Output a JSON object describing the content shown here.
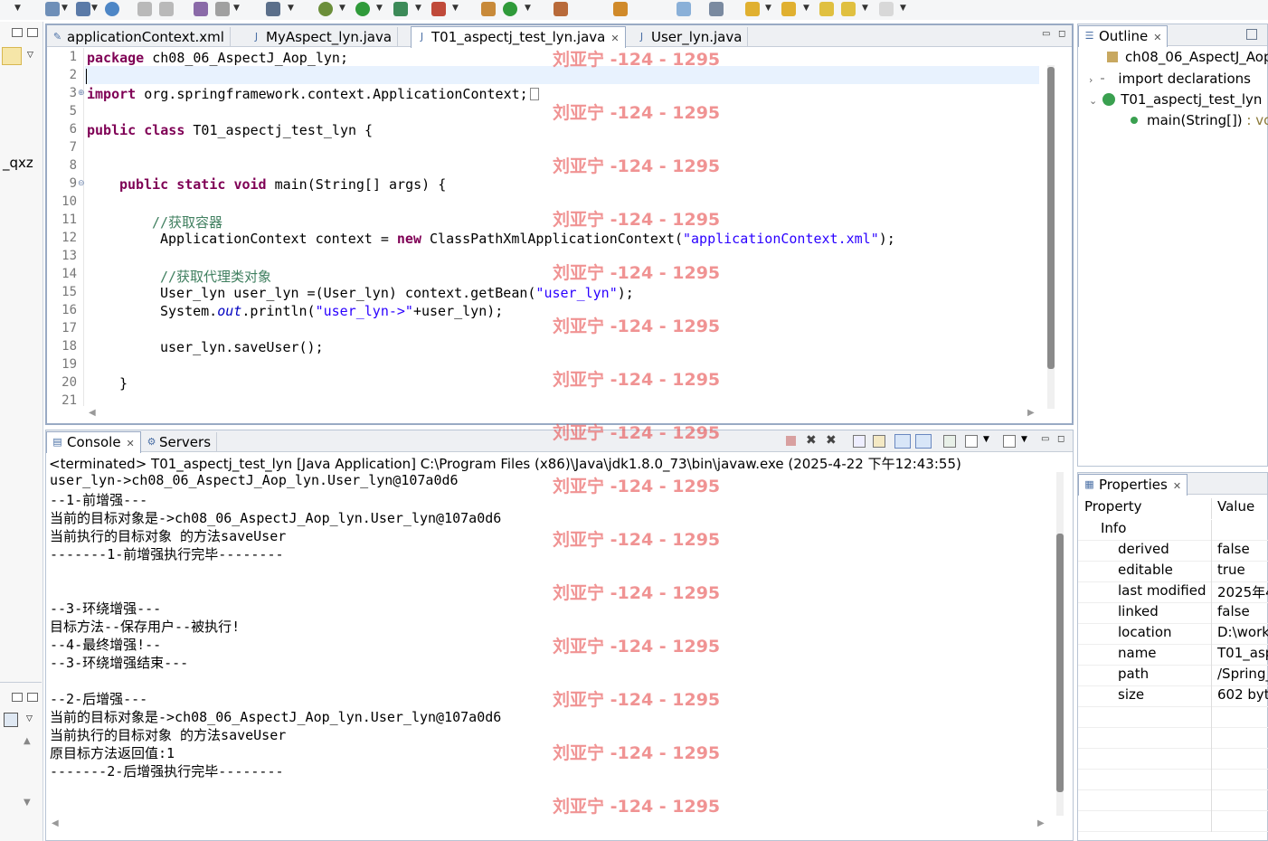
{
  "editor": {
    "tabs": [
      {
        "label": "applicationContext.xml",
        "icon": "xml-file-icon"
      },
      {
        "label": "MyAspect_lyn.java",
        "icon": "java-file-icon"
      },
      {
        "label": "T01_aspectj_test_lyn.java",
        "icon": "java-file-icon",
        "active": true
      },
      {
        "label": "User_lyn.java",
        "icon": "java-file-icon"
      }
    ],
    "line_numbers": [
      "1",
      "2",
      "3",
      "5",
      "6",
      "7",
      "8",
      "9",
      "10",
      "11",
      "12",
      "13",
      "14",
      "15",
      "16",
      "17",
      "18",
      "19",
      "20",
      "21"
    ],
    "code": {
      "l1_kw": "package",
      "l1_rest": " ch08_06_AspectJ_Aop_lyn;",
      "l3_kw": "import",
      "l3_rest": " org.springframework.context.ApplicationContext;",
      "l5_kw1": "public",
      "l5_kw2": "class",
      "l5_rest": " T01_aspectj_test_lyn {",
      "l8_kw1": "public",
      "l8_kw2": "static",
      "l8_kw3": "void",
      "l8_rest": " main(String[] args) {",
      "l10_cmt": "//获取容器",
      "l11_a": "ApplicationContext context = ",
      "l11_kw": "new",
      "l11_b": " ClassPathXmlApplicationContext(",
      "l11_str": "\"applicationContext.xml\"",
      "l11_c": ");",
      "l13_cmt": "//获取代理类对象",
      "l14_a": "User_lyn user_lyn =(User_lyn) context.getBean(",
      "l14_str": "\"user_lyn\"",
      "l14_b": ");",
      "l15_a": "System.",
      "l15_fld": "out",
      "l15_b": ".println(",
      "l15_str": "\"user_lyn->\"",
      "l15_c": "+user_lyn);",
      "l17": "user_lyn.saveUser();",
      "l19": "}"
    }
  },
  "console": {
    "tabs": [
      {
        "label": "Console",
        "icon": "console-icon"
      },
      {
        "label": "Servers",
        "icon": "servers-icon"
      }
    ],
    "header": "<terminated> T01_aspectj_test_lyn [Java Application] C:\\Program Files (x86)\\Java\\jdk1.8.0_73\\bin\\javaw.exe (2025-4-22 下午12:43:55)",
    "lines": [
      "user_lyn->ch08_06_AspectJ_Aop_lyn.User_lyn@107a0d6",
      "--1-前增强---",
      "当前的目标对象是->ch08_06_AspectJ_Aop_lyn.User_lyn@107a0d6",
      "当前执行的目标对象 的方法saveUser",
      "-------1-前增强执行完毕--------",
      "",
      "",
      "--3-环绕增强---",
      "目标方法--保存用户--被执行!",
      "--4-最终增强!--",
      "--3-环绕增强结束---",
      "",
      "--2-后增强---",
      "当前的目标对象是->ch08_06_AspectJ_Aop_lyn.User_lyn@107a0d6",
      "当前执行的目标对象 的方法saveUser",
      "原目标方法返回值:1",
      "-------2-后增强执行完毕--------"
    ]
  },
  "outline": {
    "tab": "Outline",
    "items": [
      {
        "label": "ch08_06_AspectJ_Aop",
        "icon": "package-icon"
      },
      {
        "label": "import declarations",
        "icon": "imports-icon"
      },
      {
        "label": "T01_aspectj_test_lyn",
        "icon": "class-icon"
      },
      {
        "label": "main(String[])",
        "suffix": " : vo",
        "icon": "method-icon"
      }
    ]
  },
  "properties": {
    "tab": "Properties",
    "col_property": "Property",
    "col_value": "Value",
    "group": "Info",
    "rows": [
      {
        "key": "derived",
        "value": "false"
      },
      {
        "key": "editable",
        "value": "true"
      },
      {
        "key": "last modified",
        "value": "2025年4"
      },
      {
        "key": "linked",
        "value": "false"
      },
      {
        "key": "location",
        "value": "D:\\work"
      },
      {
        "key": "name",
        "value": "T01_asp"
      },
      {
        "key": "path",
        "value": "/Spring_"
      },
      {
        "key": "size",
        "value": "602  byt"
      }
    ]
  },
  "left_strip": {
    "label": "_qxz"
  },
  "watermark": "刘亚宁 -124 - 1295",
  "colors": {
    "keyword": "#7f0055",
    "string": "#2a00ff",
    "comment": "#3f7f5f",
    "field": "#0000c0",
    "watermark": "#e65050"
  }
}
